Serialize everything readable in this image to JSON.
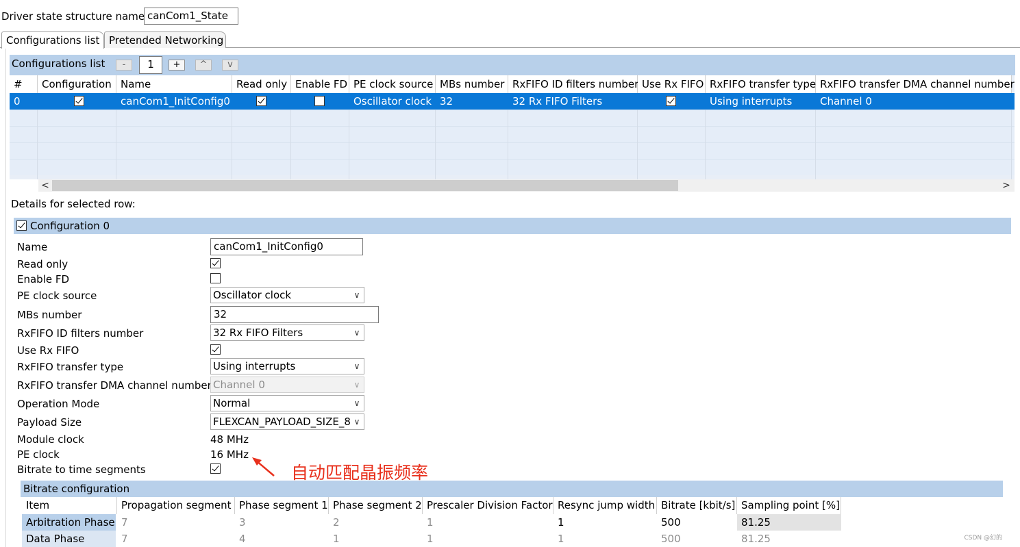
{
  "driver_state": {
    "label": "Driver state structure name",
    "value": "canCom1_State"
  },
  "tabs": [
    {
      "label": "Configurations list",
      "active": true
    },
    {
      "label": "Pretended Networking",
      "active": false
    }
  ],
  "config_list": {
    "title": "Configurations list",
    "buttons": {
      "remove": "-",
      "count": "1",
      "add": "+",
      "up": "^",
      "down": "v"
    },
    "columns": [
      "#",
      "Configuration",
      "Name",
      "Read only",
      "Enable FD",
      "PE clock source",
      "MBs number",
      "RxFIFO ID filters number",
      "Use Rx FIFO",
      "RxFIFO transfer type",
      "RxFIFO transfer DMA channel number"
    ],
    "row": {
      "index": "0",
      "configuration": true,
      "name": "canCom1_InitConfig0",
      "read_only": true,
      "enable_fd": false,
      "pe_clock_source": "Oscillator clock",
      "mbs_number": "32",
      "rxfifo_id_filters": "32 Rx FIFO Filters",
      "use_rx_fifo": true,
      "rxfifo_transfer_type": "Using interrupts",
      "rxfifo_dma_channel": "Channel 0"
    },
    "scroll": {
      "left": "<",
      "right": ">"
    }
  },
  "details": {
    "label": "Details for selected row:",
    "group_title": "Configuration 0",
    "group_checked": true,
    "fields": {
      "name": {
        "label": "Name",
        "value": "canCom1_InitConfig0"
      },
      "read_only": {
        "label": "Read only",
        "checked": true
      },
      "enable_fd": {
        "label": "Enable FD",
        "checked": false
      },
      "pe_clock_source": {
        "label": "PE clock source",
        "value": "Oscillator clock"
      },
      "mbs_number": {
        "label": "MBs number",
        "value": "32"
      },
      "rxfifo_id_filters": {
        "label": "RxFIFO ID filters number",
        "value": "32 Rx FIFO Filters"
      },
      "use_rx_fifo": {
        "label": "Use Rx FIFO",
        "checked": true
      },
      "rxfifo_transfer_type": {
        "label": "RxFIFO transfer type",
        "value": "Using interrupts"
      },
      "rxfifo_dma_channel": {
        "label": "RxFIFO transfer DMA channel number",
        "value": "Channel 0"
      },
      "operation_mode": {
        "label": "Operation Mode",
        "value": "Normal"
      },
      "payload_size": {
        "label": "Payload Size",
        "value": "FLEXCAN_PAYLOAD_SIZE_8"
      },
      "module_clock": {
        "label": "Module clock",
        "value": "48 MHz"
      },
      "pe_clock": {
        "label": "PE clock",
        "value": "16 MHz"
      },
      "bitrate_to_segments": {
        "label": "Bitrate to time segments",
        "checked": true
      }
    },
    "dropdown_arrow": "∨"
  },
  "annotation": "自动匹配晶振频率",
  "bitrate": {
    "title": "Bitrate configuration",
    "columns": [
      "Item",
      "Propagation segment",
      "Phase segment 1",
      "Phase segment 2",
      "Prescaler Division Factor",
      "Resync jump width",
      "Bitrate [kbit/s]",
      "Sampling point [%]"
    ],
    "rows": [
      [
        "Arbitration Phase",
        "7",
        "3",
        "2",
        "1",
        "1",
        "500",
        "81.25"
      ],
      [
        "Data Phase",
        "7",
        "4",
        "1",
        "1",
        "1",
        "500",
        "81.25"
      ]
    ]
  },
  "watermark": "CSDN @幻的",
  "colors": {
    "selection": "#0a78d7",
    "header_blue": "#b8d0ea",
    "annotation": "#e8301c"
  }
}
